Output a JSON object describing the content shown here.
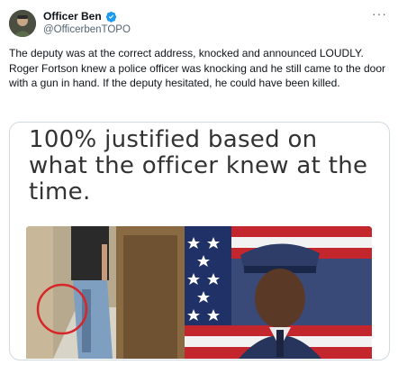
{
  "author": {
    "display_name": "Officer Ben",
    "handle": "@OfficerbenTOPO",
    "avatar_icon": "profile-avatar",
    "verified_icon": "verified-badge-icon",
    "verified_color": "#1d9bf0"
  },
  "tweet": {
    "text": "The deputy was at the correct address, knocked and announced LOUDLY. Roger Fortson knew a police officer was knocking and he still came to the door with a gun in hand. If the deputy hesitated, he could have been killed."
  },
  "media": {
    "headline": "100% justified based on what the officer knew at the time."
  },
  "menu": {
    "more_label": "···"
  }
}
